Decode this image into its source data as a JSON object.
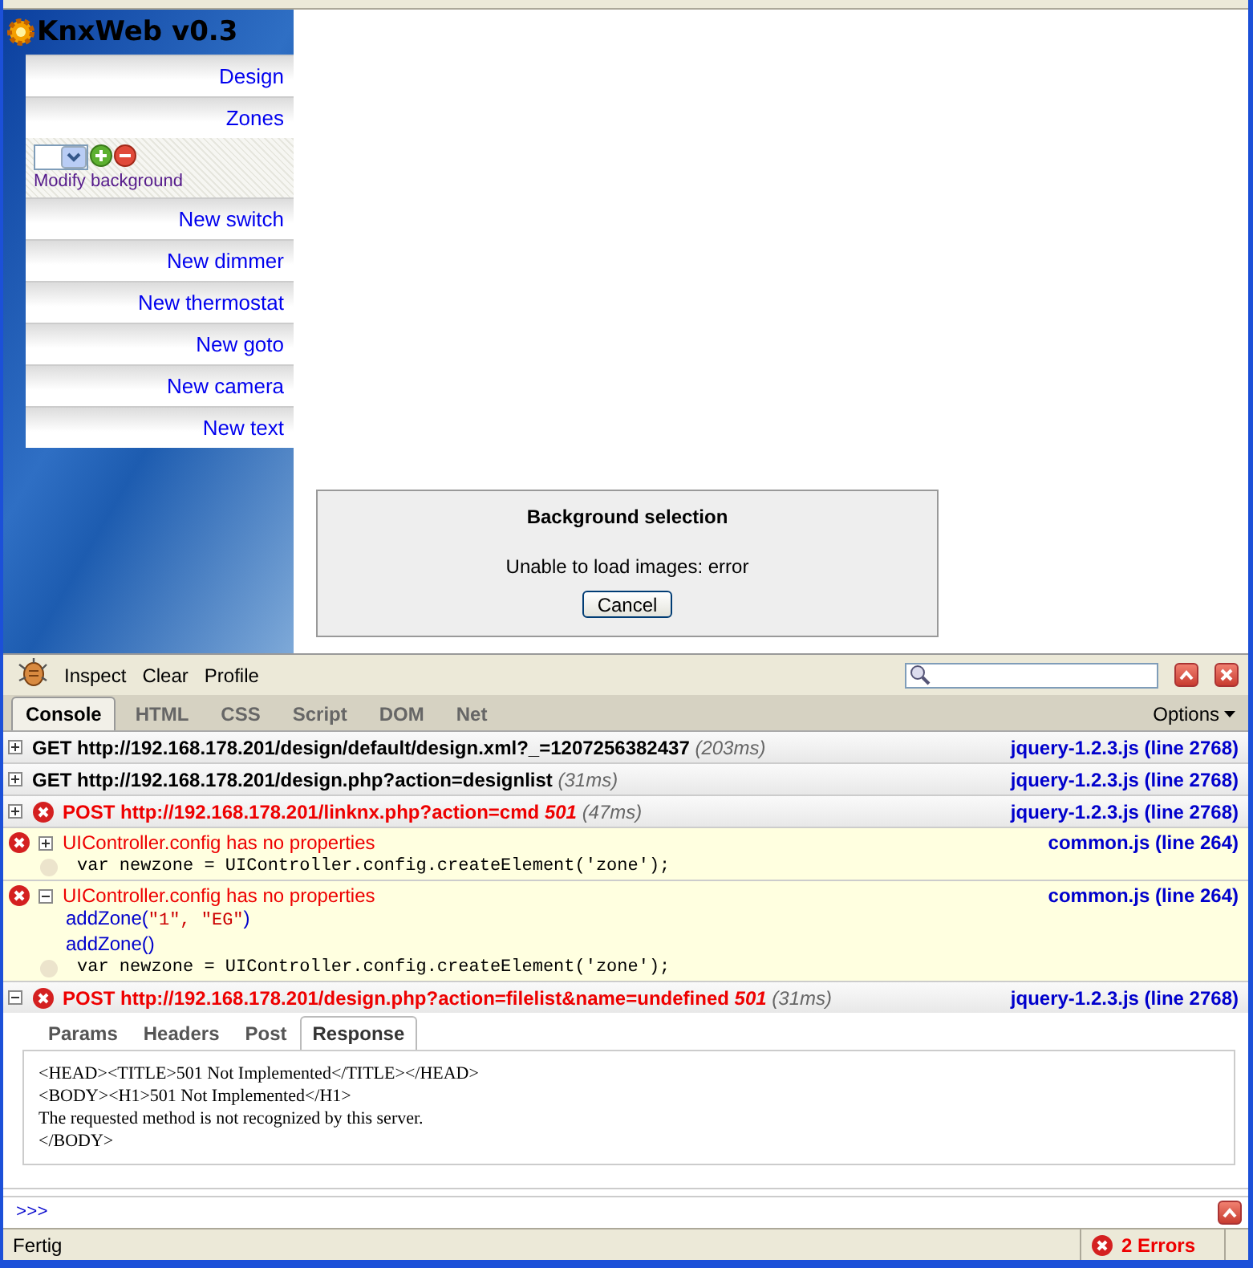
{
  "app": {
    "title": "KnxWeb v0.3"
  },
  "menu_top": [
    "Design",
    "Zones"
  ],
  "zone_tools": {
    "link": "Modify background"
  },
  "menu_bottom": [
    "New switch",
    "New dimmer",
    "New thermostat",
    "New goto",
    "New camera",
    "New text"
  ],
  "dialog": {
    "title": "Background selection",
    "message": "Unable to load images: error",
    "button": "Cancel"
  },
  "firebug": {
    "toolbar": [
      "Inspect",
      "Clear",
      "Profile"
    ],
    "tabs": [
      {
        "label": "Console",
        "selected": true
      },
      {
        "label": "HTML",
        "selected": false
      },
      {
        "label": "CSS",
        "selected": false
      },
      {
        "label": "Script",
        "selected": false
      },
      {
        "label": "DOM",
        "selected": false
      },
      {
        "label": "Net",
        "selected": false
      }
    ],
    "options": "Options",
    "log": [
      {
        "kind": "request",
        "expanded": false,
        "error": false,
        "method": "GET",
        "url": "http://192.168.178.201/design/default/design.xml?_=1207256382437",
        "time": "(203ms)",
        "source": "jquery-1.2.3.js (line 2768)"
      },
      {
        "kind": "request",
        "expanded": false,
        "error": false,
        "method": "GET",
        "url": "http://192.168.178.201/design.php?action=designlist",
        "time": "(31ms)",
        "source": "jquery-1.2.3.js (line 2768)"
      },
      {
        "kind": "request",
        "expanded": false,
        "error": true,
        "method": "POST",
        "url": "http://192.168.178.201/linknx.php?action=cmd",
        "status": "501",
        "time": "(47ms)",
        "source": "jquery-1.2.3.js (line 2768)"
      },
      {
        "kind": "error",
        "expanded": false,
        "message": "UIController.config has no properties",
        "source": "common.js (line 264)",
        "code": "var newzone = UIController.config.createElement('zone');"
      },
      {
        "kind": "error",
        "expanded": true,
        "message": "UIController.config has no properties",
        "source": "common.js (line 264)",
        "trace": [
          [
            "addZone(",
            "\"1\", \"EG\"",
            ")"
          ],
          [
            "addZone()"
          ]
        ],
        "code": "var newzone = UIController.config.createElement('zone');"
      },
      {
        "kind": "request",
        "expanded": true,
        "error": true,
        "method": "POST",
        "url": "http://192.168.178.201/design.php?action=filelist&name=undefined",
        "status": "501",
        "time": "(31ms)",
        "source": "jquery-1.2.3.js (line 2768)",
        "subtabs": [
          {
            "label": "Params",
            "selected": false
          },
          {
            "label": "Headers",
            "selected": false
          },
          {
            "label": "Post",
            "selected": false
          },
          {
            "label": "Response",
            "selected": true
          }
        ],
        "response": [
          "<HEAD><TITLE>501 Not Implemented</TITLE></HEAD>",
          "<BODY><H1>501 Not Implemented</H1>",
          "The requested method is not recognized by this server.",
          "</BODY>"
        ]
      }
    ],
    "command_prompt": ">>>"
  },
  "status_bar": {
    "text": "Fertig",
    "errors": "2 Errors"
  }
}
